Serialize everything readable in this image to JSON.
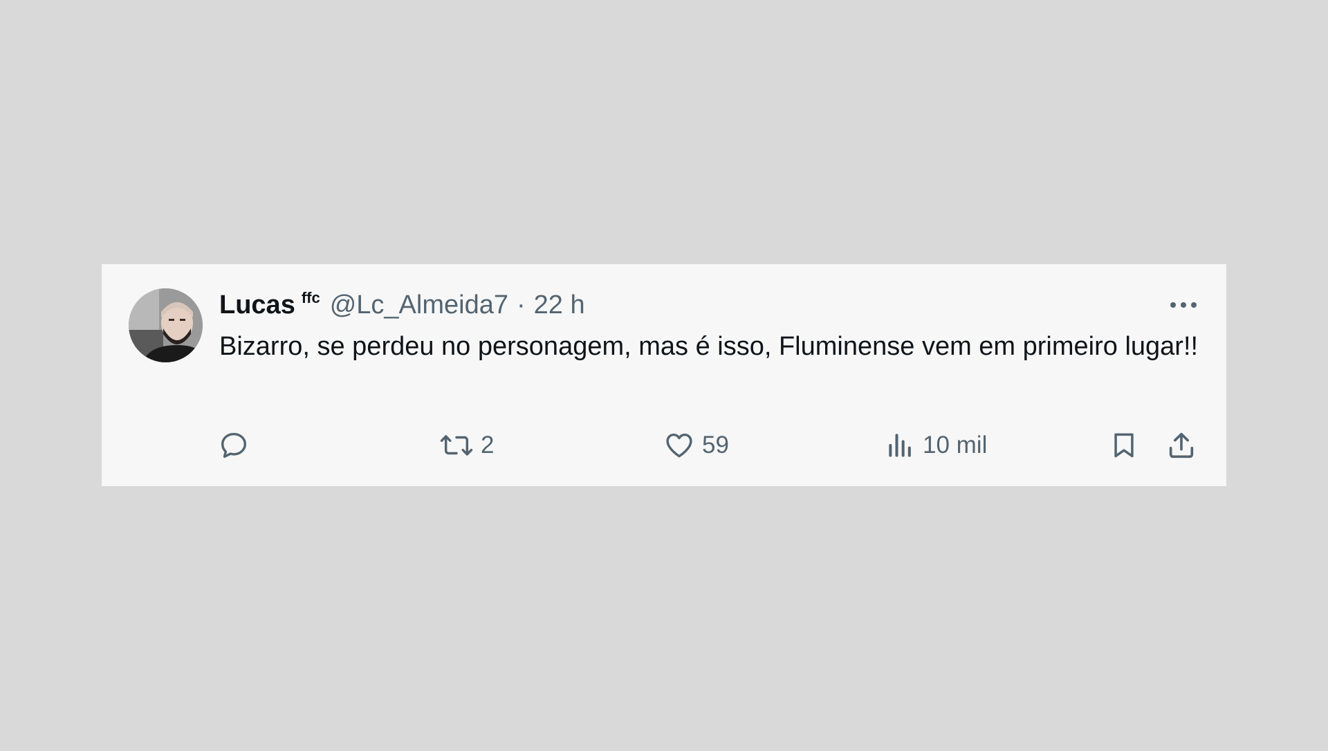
{
  "tweet": {
    "author": {
      "name": "Lucas",
      "badge": "ffc",
      "handle": "@Lc_Almeida7",
      "avatar_icon": "profile-photo"
    },
    "separator": "·",
    "time": "22 h",
    "text": "Bizarro, se perdeu no personagem, mas é isso, Fluminense vem em primeiro lugar!!",
    "actions": {
      "reply": {
        "icon": "reply-icon",
        "count": ""
      },
      "retweet": {
        "icon": "retweet-icon",
        "count": "2"
      },
      "like": {
        "icon": "heart-icon",
        "count": "59"
      },
      "views": {
        "icon": "analytics-icon",
        "count": "10 mil"
      },
      "bookmark": {
        "icon": "bookmark-icon"
      },
      "share": {
        "icon": "share-icon"
      }
    },
    "more_icon": "more-icon"
  },
  "colors": {
    "background": "#d9d9d9",
    "card": "#f7f7f7",
    "text_primary": "#0f1419",
    "text_secondary": "#536471"
  }
}
